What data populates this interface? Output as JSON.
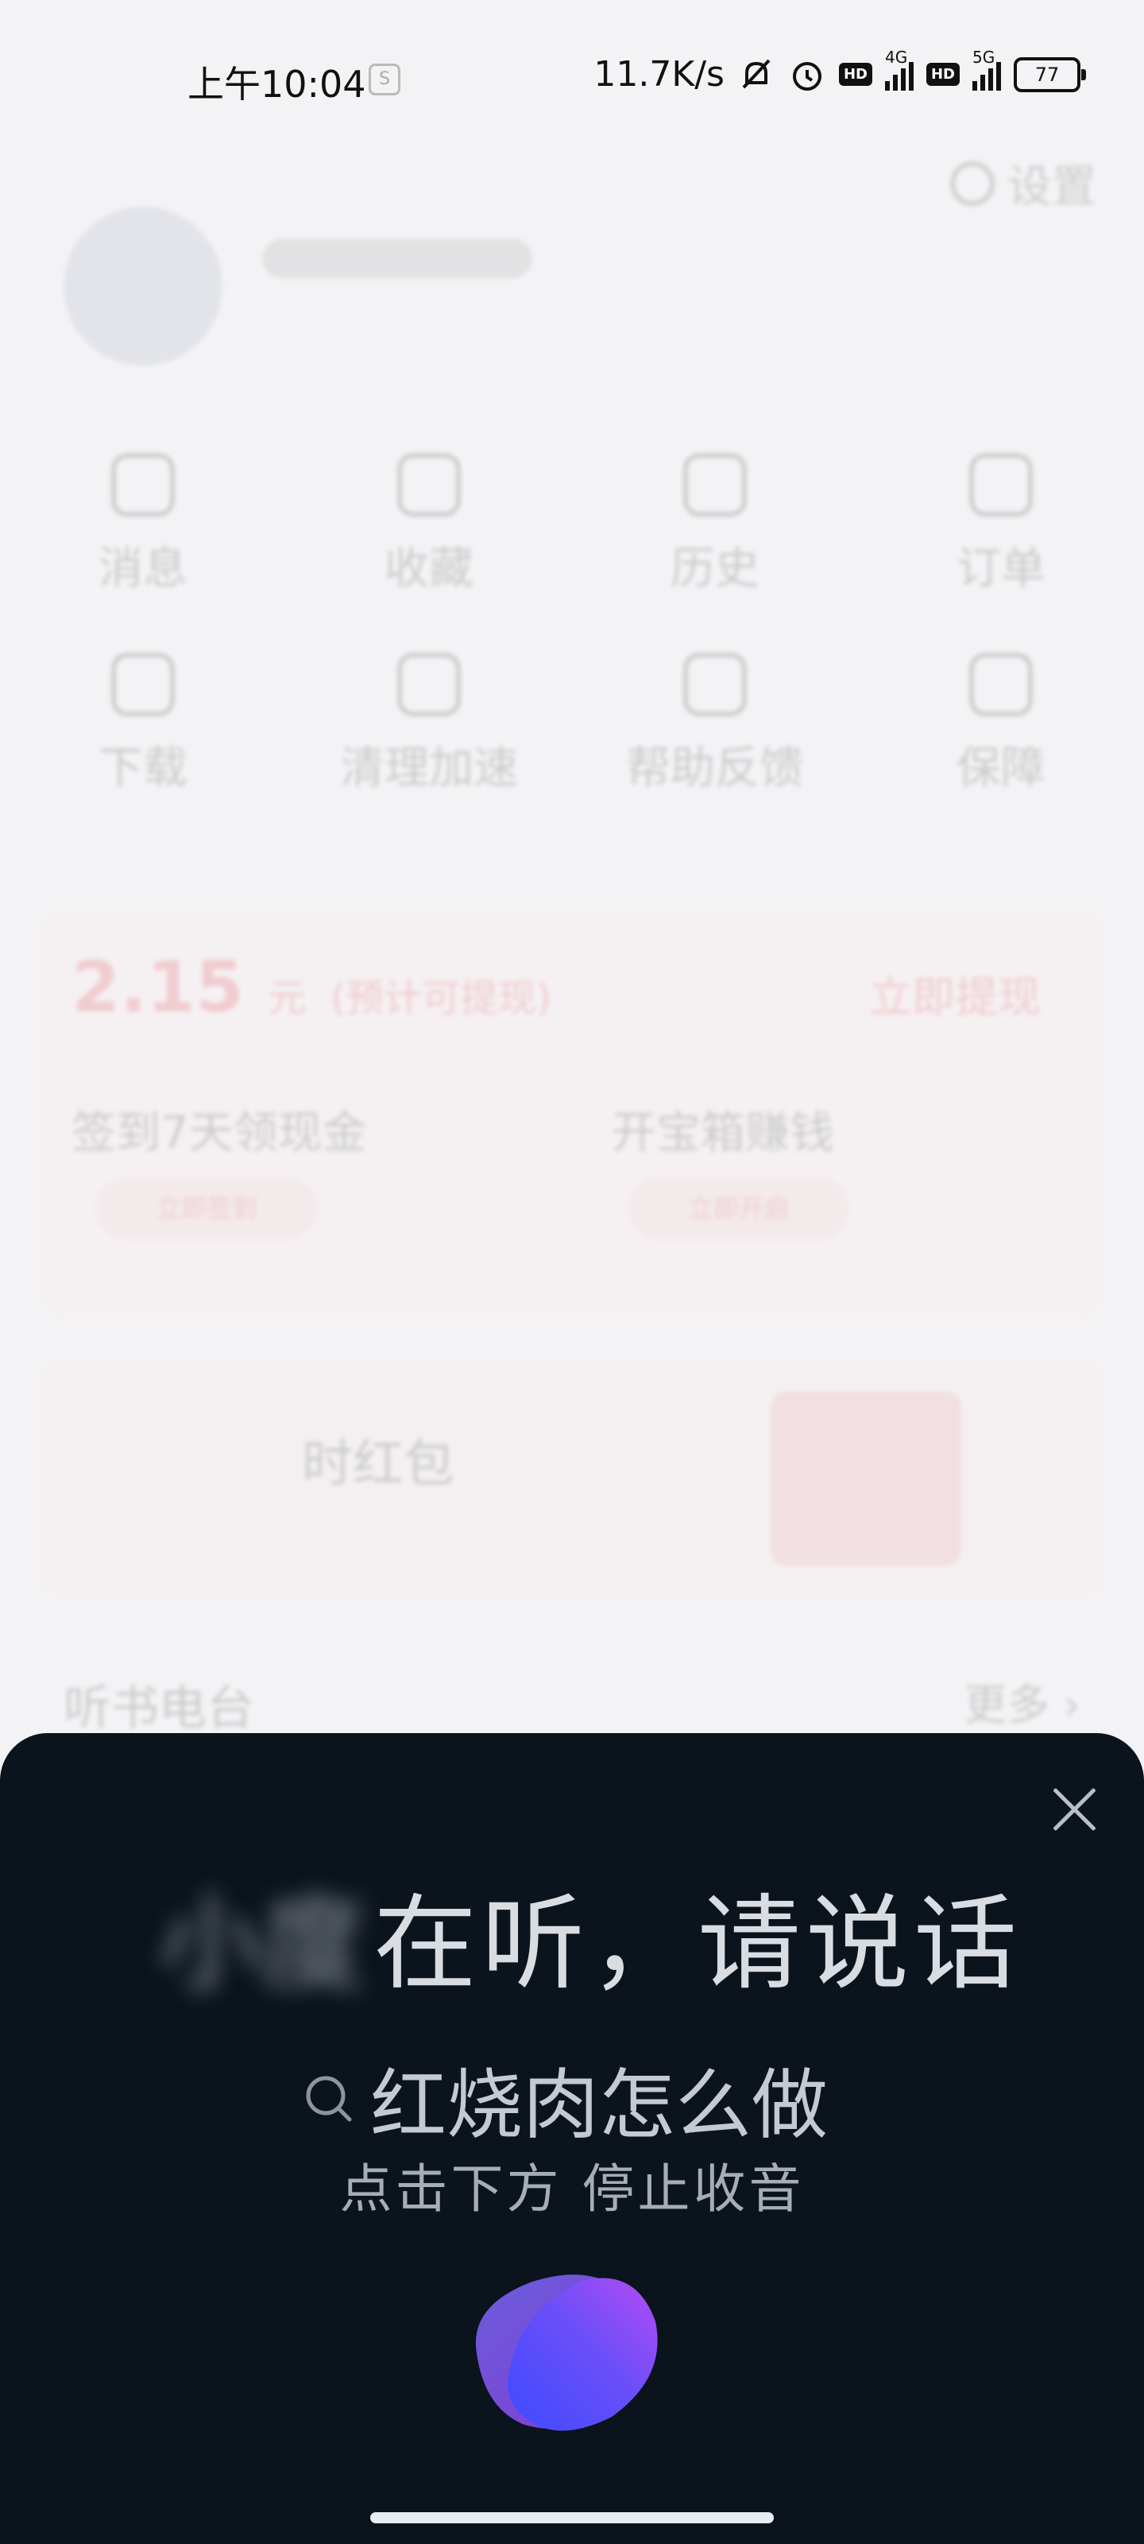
{
  "status_bar": {
    "time": "上午10:04",
    "net_speed": "11.7K/s",
    "signal_1": "4G",
    "signal_2": "5G",
    "hd": "HD",
    "battery": "77"
  },
  "background": {
    "settings_label": "设置",
    "grid_items": [
      "消息",
      "收藏",
      "历史",
      "订单",
      "下载",
      "清理加速",
      "帮助反馈",
      "保障"
    ],
    "earn": {
      "amount": "2.15",
      "unit": "元",
      "note": "(预计可提现)",
      "withdraw_label": "立即提现",
      "task_1": "签到7天领现金",
      "task_1_btn": "立即签到",
      "task_2": "开宝箱赚钱",
      "task_2_btn": "立即开启"
    },
    "redpacket_text": "时红包",
    "radio_title": "听书电台",
    "radio_more": "更多 ›"
  },
  "voice": {
    "assistant_name": "小度",
    "listening_text": "在听，请说话",
    "query_text": "红烧肉怎么做",
    "hint_text": "点击下方 停止收音",
    "colors": {
      "sheet_bg": "#0b131c",
      "orb_start": "#3d4bff",
      "orb_end": "#b44cf5"
    }
  }
}
